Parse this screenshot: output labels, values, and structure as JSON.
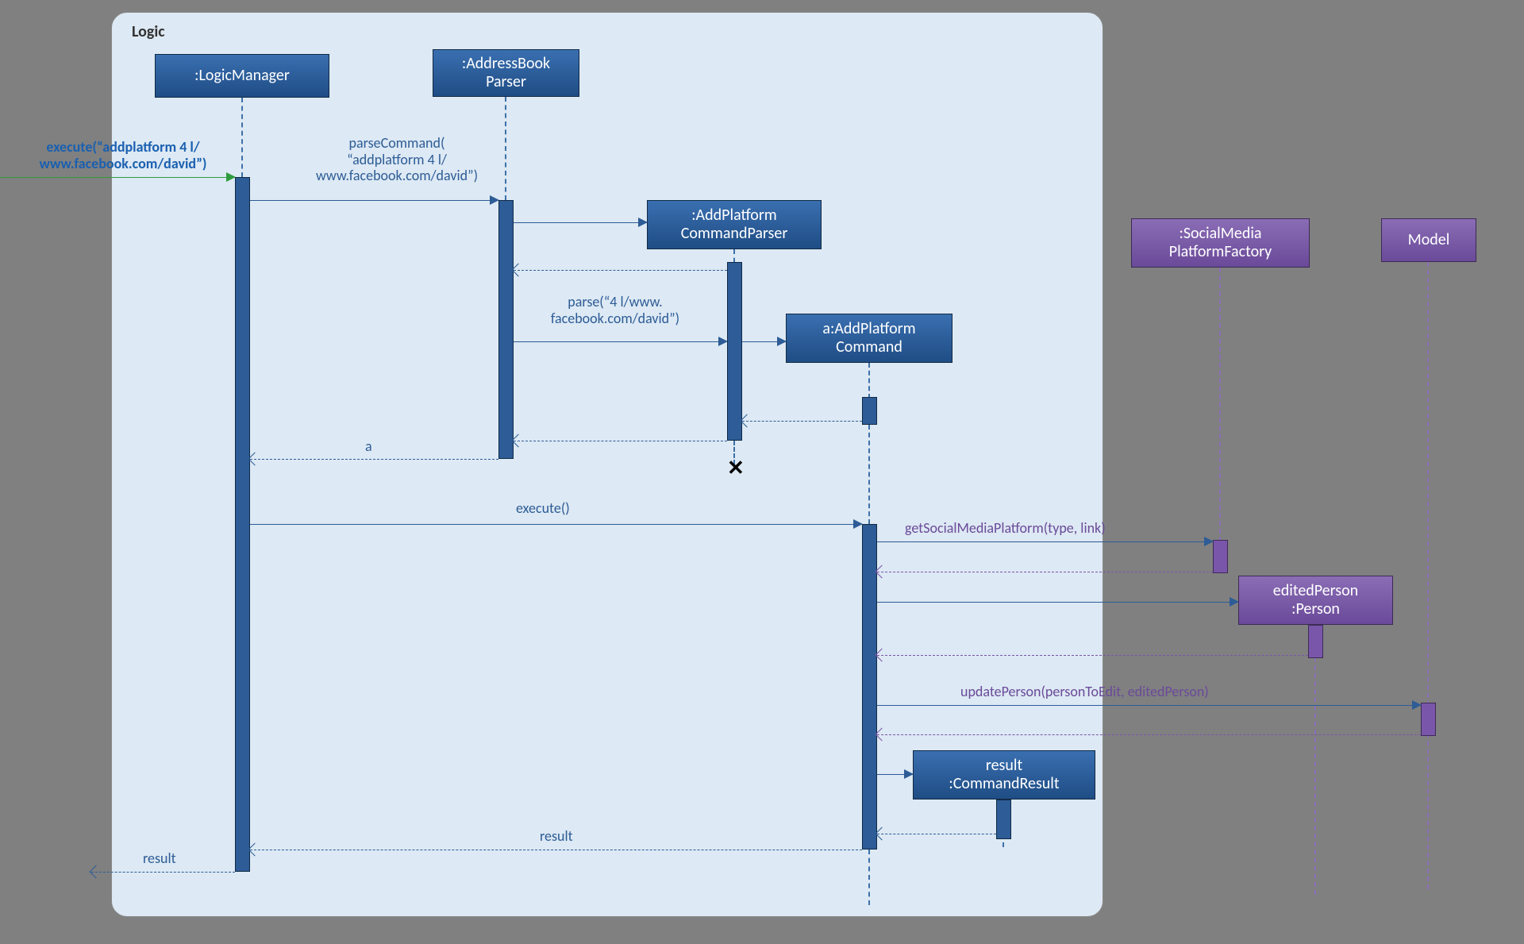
{
  "panel_label": "Logic",
  "participants": {
    "logicManager": ":LogicManager",
    "addressBookParser": ":AddressBook\nParser",
    "addPlatformCommandParser": ":AddPlatform\nCommandParser",
    "addPlatformCommand": "a:AddPlatform\nCommand",
    "commandResult": "result\n:CommandResult",
    "socialMediaFactory": ":SocialMedia\nPlatformFactory",
    "model": "Model",
    "editedPerson": "editedPerson\n:Person"
  },
  "messages": {
    "initial_execute": "execute(“addplatform 4 l/\nwww.facebook.com/david”)",
    "parseCommand": "parseCommand(\n“addplatform 4 l/\nwww.facebook.com/david”)",
    "parse": "parse(“4 l/www.\nfacebook.com/david”)",
    "return_a": "a",
    "execute": "execute()",
    "getSocialMediaPlatform": "getSocialMediaPlatform(type, link)",
    "updatePerson": "updatePerson(personToEdit, editedPerson)",
    "return_result": "result",
    "final_result": "result"
  }
}
